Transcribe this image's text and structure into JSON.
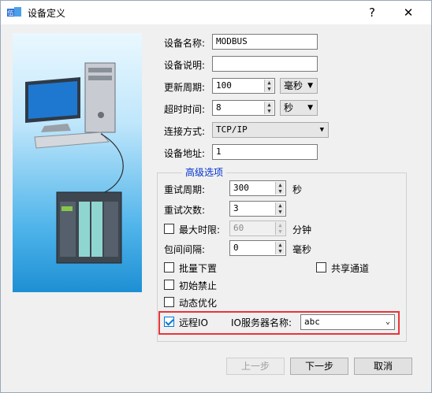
{
  "window": {
    "title": "设备定义",
    "help_glyph": "?",
    "close_glyph": "✕"
  },
  "device": {
    "name_label": "设备名称:",
    "name_value": "MODBUS",
    "desc_label": "设备说明:",
    "desc_value": "",
    "update_label": "更新周期:",
    "update_value": "100",
    "update_unit": "毫秒",
    "timeout_label": "超时时间:",
    "timeout_value": "8",
    "timeout_unit": "秒",
    "conn_label": "连接方式:",
    "conn_value": "TCP/IP",
    "addr_label": "设备地址:",
    "addr_value": "1"
  },
  "advanced": {
    "title": "高级选项",
    "retry_period_label": "重试周期:",
    "retry_period_value": "300",
    "retry_period_unit": "秒",
    "retry_count_label": "重试次数:",
    "retry_count_value": "3",
    "max_limit_label": "最大时限:",
    "max_limit_value": "60",
    "max_limit_unit": "分钟",
    "max_limit_checked": false,
    "packet_interval_label": "包间间隔:",
    "packet_interval_value": "0",
    "packet_interval_unit": "毫秒",
    "batch_label": "批量下置",
    "batch_checked": false,
    "shared_label": "共享通道",
    "shared_checked": false,
    "init_disable_label": "初始禁止",
    "init_disable_checked": false,
    "dynamic_label": "动态优化",
    "dynamic_checked": false,
    "remote_label": "远程IO",
    "remote_checked": true,
    "server_name_label": "IO服务器名称:",
    "server_name_value": "abc"
  },
  "buttons": {
    "prev": "上一步",
    "next": "下一步",
    "cancel": "取消"
  },
  "colors": {
    "accent": "#0078d7",
    "highlight": "#e8353a",
    "group_title": "#0033cc"
  }
}
